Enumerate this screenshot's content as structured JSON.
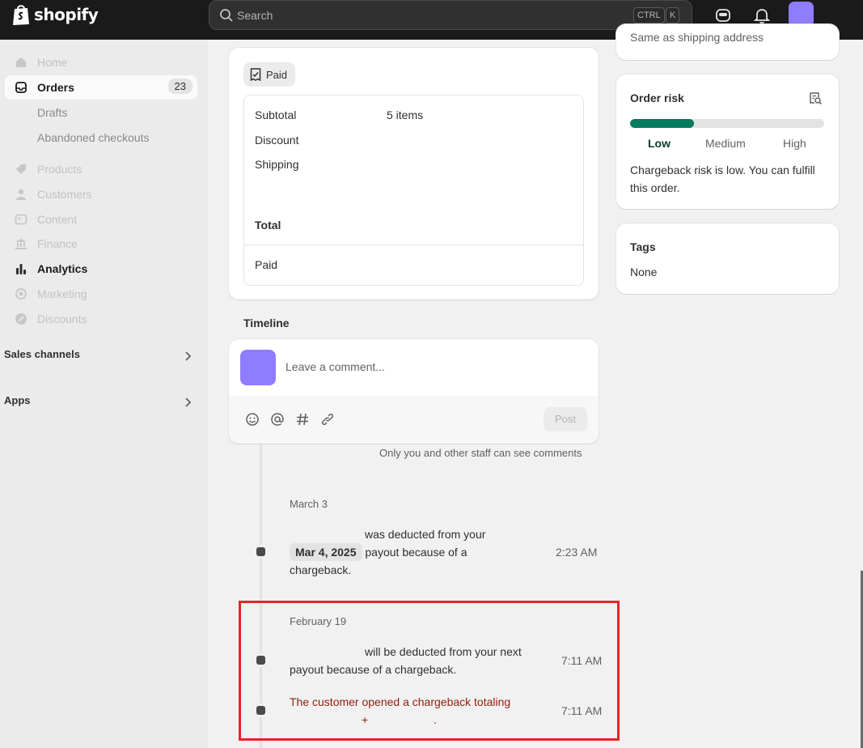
{
  "topbar": {
    "logo_text": "shopify",
    "search_placeholder": "Search",
    "kbd_ctrl": "CTRL",
    "kbd_k": "K"
  },
  "sidebar": {
    "items": [
      {
        "label": "Home"
      },
      {
        "label": "Orders",
        "badge": "23"
      },
      {
        "label": "Drafts"
      },
      {
        "label": "Abandoned checkouts"
      },
      {
        "label": "Products"
      },
      {
        "label": "Customers"
      },
      {
        "label": "Content"
      },
      {
        "label": "Finance"
      },
      {
        "label": "Analytics"
      },
      {
        "label": "Marketing"
      },
      {
        "label": "Discounts"
      }
    ],
    "sales_channels": "Sales channels",
    "apps": "Apps"
  },
  "payment_card": {
    "status_pill": "Paid",
    "subtotal_label": "Subtotal",
    "subtotal_items": "5 items",
    "discount_label": "Discount",
    "shipping_label": "Shipping",
    "total_label": "Total",
    "paid_label": "Paid"
  },
  "address_card": {
    "partial_text": "Same as shipping address"
  },
  "order_risk": {
    "title": "Order risk",
    "level": 0.33,
    "levels": [
      "Low",
      "Medium",
      "High"
    ],
    "description": "Chargeback risk is low. You can fulfill this order.",
    "accent": "#047b5d"
  },
  "tags": {
    "title": "Tags",
    "value": "None"
  },
  "timeline": {
    "title": "Timeline",
    "comment_placeholder": "Leave a comment...",
    "post_label": "Post",
    "staff_note": "Only you and other staff can see comments",
    "groups": [
      {
        "date": "March 3",
        "events": [
          {
            "text_a": "was deducted from your",
            "chip": "Mar 4, 2025",
            "text_b": "payout because of a",
            "text_c": "chargeback.",
            "time": "2:23 AM"
          }
        ]
      },
      {
        "date": "February 19",
        "events": [
          {
            "text_a": "will be deducted from your next",
            "text_b": "payout because of a chargeback.",
            "time": "7:11 AM"
          },
          {
            "text_a": "The customer opened a chargeback totaling",
            "text_b": "+",
            "text_c": ".",
            "time": "7:11 AM"
          }
        ]
      }
    ]
  }
}
